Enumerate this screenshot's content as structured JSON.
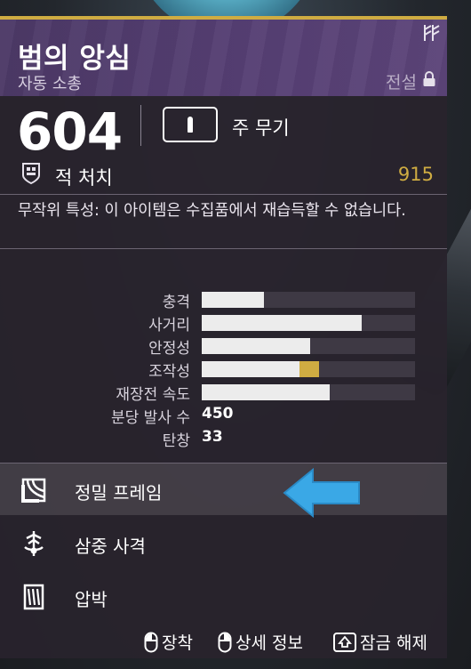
{
  "item": {
    "name": "범의 앙심",
    "type": "자동 소총",
    "rarity": "전설",
    "power": "604",
    "ammo_type": "주 무기"
  },
  "tracker": {
    "label": "적 처치",
    "value": "915"
  },
  "description": "무작위 특성: 이 아이템은 수집품에서 재습득할 수 없습니다.",
  "stats": [
    {
      "label": "충격",
      "value": 29
    },
    {
      "label": "사거리",
      "value": 75
    },
    {
      "label": "안정성",
      "value": 51
    },
    {
      "label": "조작성",
      "value": 46,
      "modifier": 9
    },
    {
      "label": "재장전 속도",
      "value": 60
    }
  ],
  "numeric_stats": [
    {
      "label": "분당 발사 수",
      "value": "450"
    },
    {
      "label": "탄창",
      "value": "33"
    }
  ],
  "perks": [
    {
      "label": "정밀 프레임",
      "icon": "precision-frame-icon",
      "selected": true
    },
    {
      "label": "삼중 사격",
      "icon": "triple-tap-icon",
      "selected": false
    },
    {
      "label": "압박",
      "icon": "pressure-icon",
      "selected": false
    }
  ],
  "footer": {
    "equip": "장착",
    "details": "상세 정보",
    "unlock": "잠금 해제"
  },
  "colors": {
    "header": "#563f74",
    "accent_gold": "#cfac42",
    "arrow_blue": "#3aa8e6",
    "panel": "#28232d"
  }
}
